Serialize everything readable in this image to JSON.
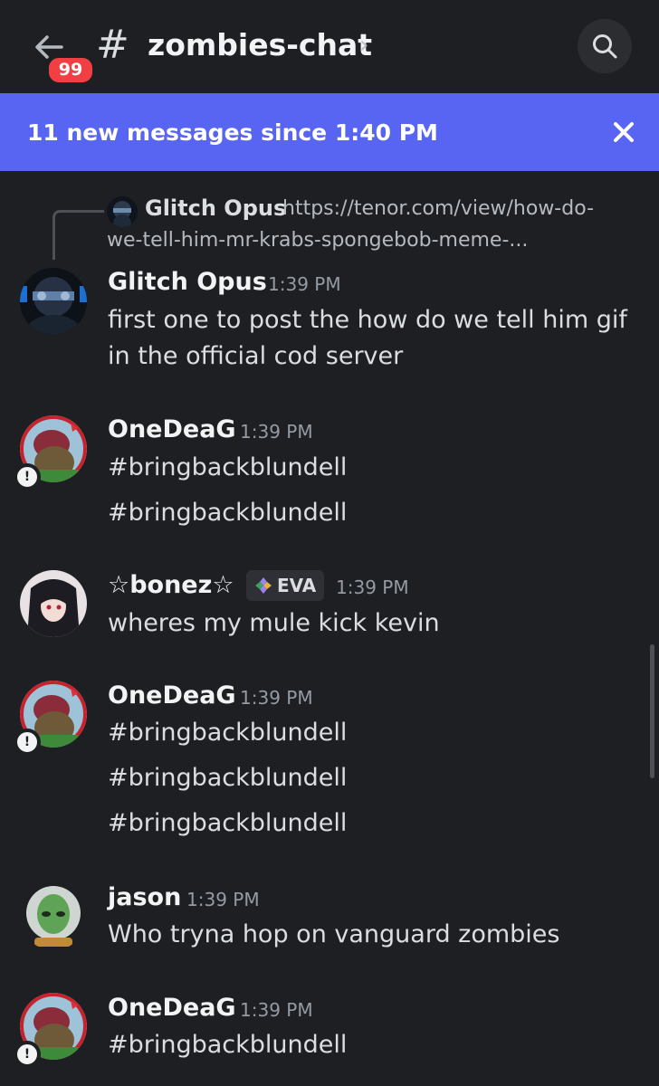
{
  "header": {
    "badge_count": "99",
    "channel_name": "zombies-chat",
    "hash_symbol": "#",
    "chevron": "›"
  },
  "banner": {
    "text": "11 new messages since 1:40 PM"
  },
  "reply": {
    "author": "Glitch Opus",
    "text_line1": "https://tenor.com/view/how-do-",
    "text_line2": "we-tell-him-mr-krabs-spongebob-meme-..."
  },
  "messages": [
    {
      "author": "Glitch Opus",
      "time": "1:39 PM",
      "lines": [
        "first one to post the how do we tell him gif",
        "in the official cod server"
      ]
    },
    {
      "author": "OneDeaG",
      "time": "1:39 PM",
      "lines": [
        "#bringbackblundell",
        "#bringbackblundell"
      ]
    },
    {
      "author": "☆bonez☆",
      "role_tag": "EVA",
      "time": "1:39 PM",
      "lines": [
        "wheres my mule kick kevin"
      ]
    },
    {
      "author": "OneDeaG",
      "time": "1:39 PM",
      "lines": [
        "#bringbackblundell",
        "#bringbackblundell",
        "#bringbackblundell"
      ]
    },
    {
      "author": "jason",
      "time": "1:39 PM",
      "lines": [
        "Who tryna hop on vanguard zombies"
      ]
    },
    {
      "author": "OneDeaG",
      "time": "1:39 PM",
      "lines": [
        "#bringbackblundell"
      ]
    }
  ],
  "status_glyph": "!",
  "colors": {
    "background": "#1e1f22",
    "banner": "#5865f2",
    "badge": "#f23f43",
    "timestamp": "#949ba4"
  }
}
